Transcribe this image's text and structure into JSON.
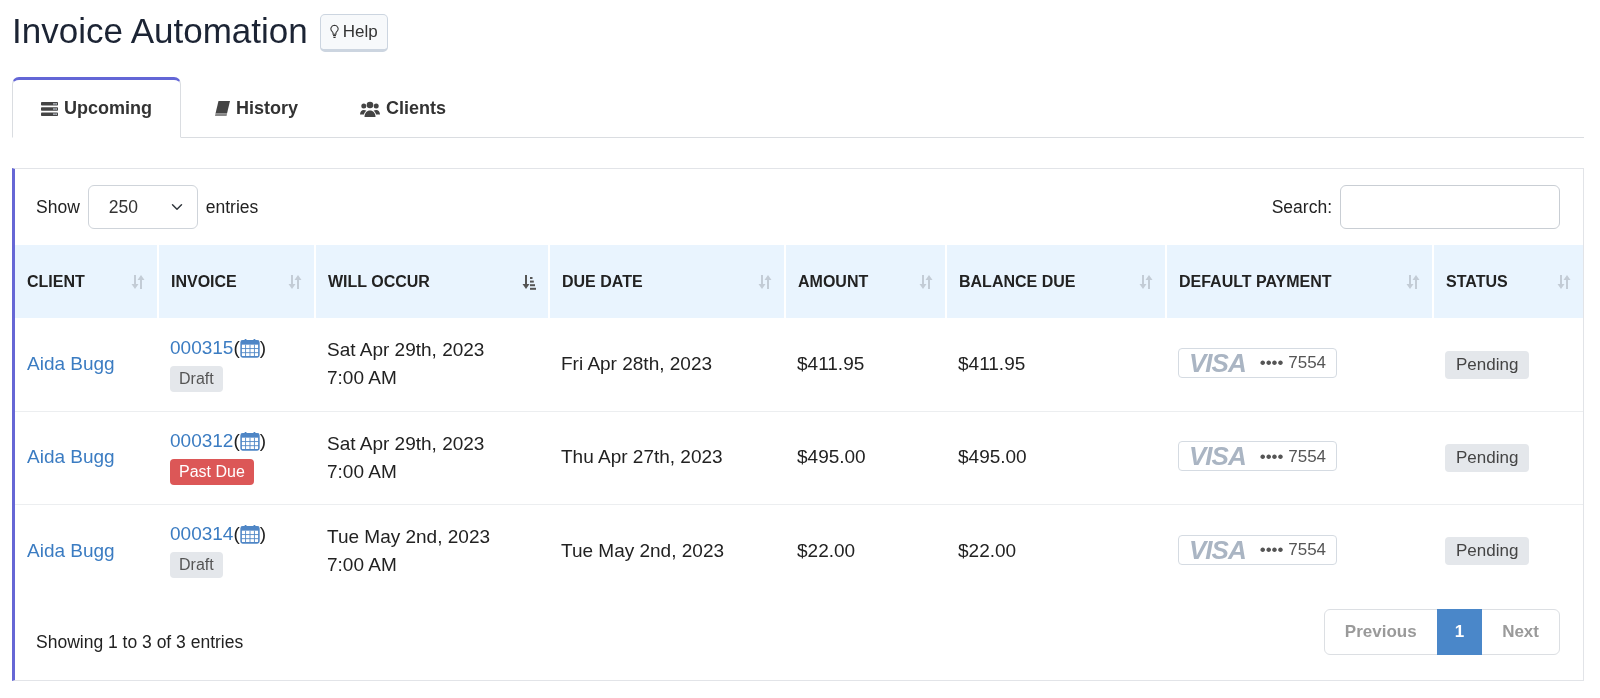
{
  "header": {
    "title": "Invoice Automation",
    "help_button": "Help"
  },
  "tabs": [
    {
      "label": "Upcoming",
      "selected": true
    },
    {
      "label": "History",
      "selected": false
    },
    {
      "label": "Clients",
      "selected": false
    }
  ],
  "table_controls": {
    "show_label": "Show",
    "entries_value": "250",
    "entries_label": "entries",
    "search_label": "Search:"
  },
  "table": {
    "columns": [
      {
        "label": "CLIENT",
        "sorted": false
      },
      {
        "label": "INVOICE",
        "sorted": false
      },
      {
        "label": "WILL OCCUR",
        "sorted": true
      },
      {
        "label": "DUE DATE",
        "sorted": false
      },
      {
        "label": "AMOUNT",
        "sorted": false
      },
      {
        "label": "BALANCE DUE",
        "sorted": false
      },
      {
        "label": "DEFAULT PAYMENT",
        "sorted": false
      },
      {
        "label": "STATUS",
        "sorted": false
      }
    ],
    "rows": [
      {
        "client": "Aida Bugg",
        "invoice": "000315",
        "bracket_open": "(",
        "bracket_close": ")",
        "tag": {
          "label": "Draft",
          "kind": "neutral"
        },
        "will_occur": {
          "date": "Sat Apr 29th, 2023",
          "time": "7:00 AM"
        },
        "due_date": "Fri Apr 28th, 2023",
        "amount": "$411.95",
        "balance_due": "$411.95",
        "default_payment": {
          "brand": "VISA",
          "number": "•••• 7554"
        },
        "status": "Pending"
      },
      {
        "client": "Aida Bugg",
        "invoice": "000312",
        "bracket_open": "(",
        "bracket_close": ")",
        "tag": {
          "label": "Past Due",
          "kind": "danger"
        },
        "will_occur": {
          "date": "Sat Apr 29th, 2023",
          "time": "7:00 AM"
        },
        "due_date": "Thu Apr 27th, 2023",
        "amount": "$495.00",
        "balance_due": "$495.00",
        "default_payment": {
          "brand": "VISA",
          "number": "•••• 7554"
        },
        "status": "Pending"
      },
      {
        "client": "Aida Bugg",
        "invoice": "000314",
        "bracket_open": "(",
        "bracket_close": ")",
        "tag": {
          "label": "Draft",
          "kind": "neutral"
        },
        "will_occur": {
          "date": "Tue May 2nd, 2023",
          "time": "7:00 AM"
        },
        "due_date": "Tue May 2nd, 2023",
        "amount": "$22.00",
        "balance_due": "$22.00",
        "default_payment": {
          "brand": "VISA",
          "number": "•••• 7554"
        },
        "status": "Pending"
      }
    ]
  },
  "footer": {
    "info": "Showing 1 to 3 of 3 entries",
    "pagination": {
      "previous": {
        "label": "Previous",
        "disabled": true
      },
      "pages": [
        {
          "label": "1",
          "selected": true
        }
      ],
      "next": {
        "label": "Next",
        "disabled": true
      }
    }
  }
}
